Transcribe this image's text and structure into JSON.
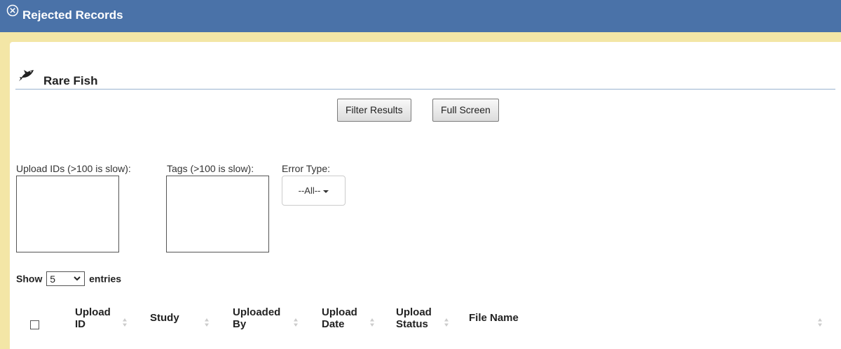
{
  "window": {
    "title": "Rejected Records",
    "close_icon": "circle-x-icon"
  },
  "section": {
    "title": "Rare Fish",
    "icon": "fish-icon"
  },
  "toolbar": {
    "filter_label": "Filter Results",
    "fullscreen_label": "Full Screen"
  },
  "filters": {
    "upload_ids_label": "Upload IDs (>100 is slow):",
    "tags_label": "Tags (>100 is slow):",
    "error_type_label": "Error Type:",
    "error_type_value": "--All--"
  },
  "entries": {
    "show_label": "Show",
    "value": "5",
    "suffix": "entries"
  },
  "table": {
    "columns": [
      {
        "line1": "Upload",
        "line2": "ID"
      },
      {
        "line1": "Study",
        "line2": ""
      },
      {
        "line1": "Uploaded",
        "line2": "By"
      },
      {
        "line1": "Upload",
        "line2": "Date"
      },
      {
        "line1": "Upload",
        "line2": "Status"
      },
      {
        "line1": "File Name",
        "line2": ""
      }
    ]
  },
  "colors": {
    "header_blue": "#4a72a8",
    "panel_yellow": "#f3e6a6",
    "divider": "#9ab3d0"
  }
}
